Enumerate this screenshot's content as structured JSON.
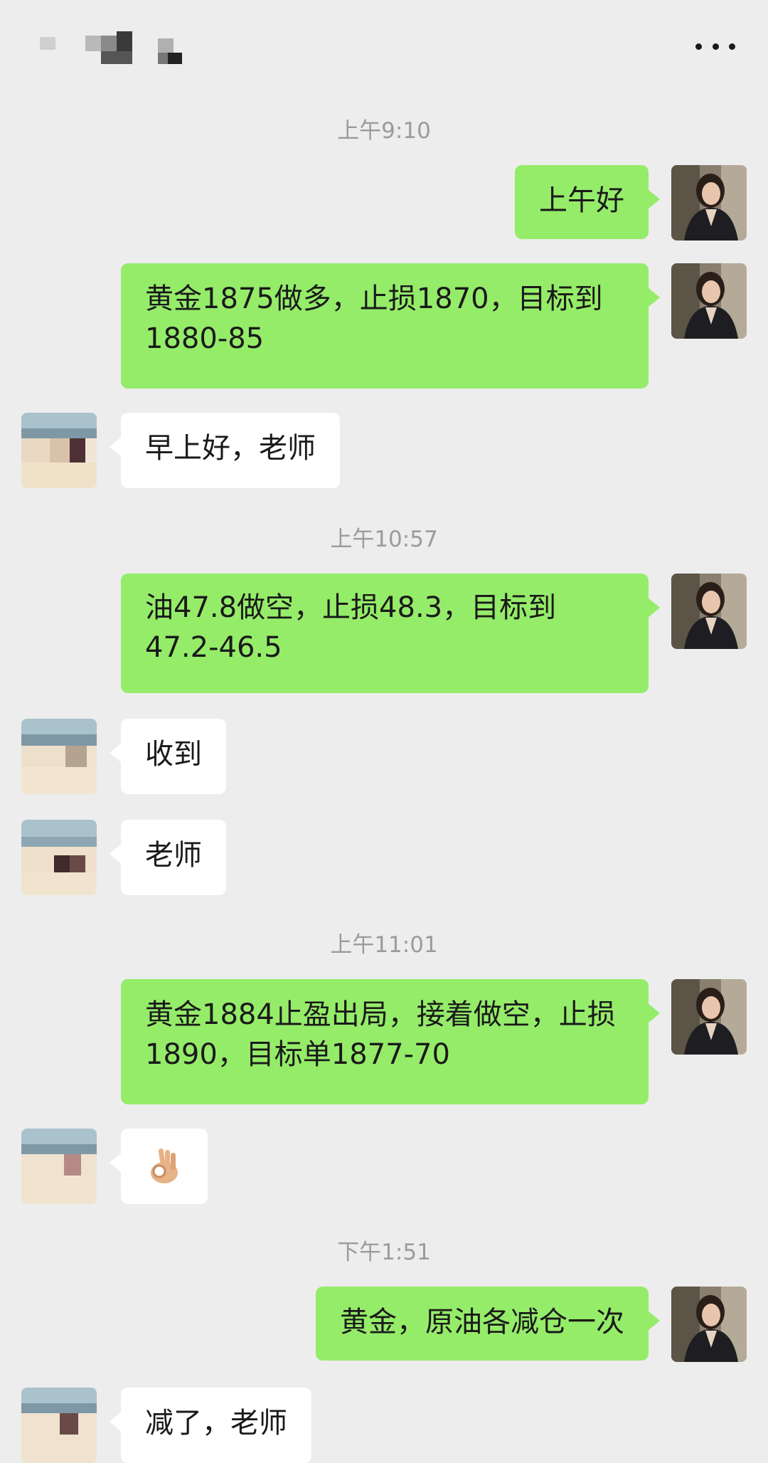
{
  "header": {
    "more_icon": "more-icon"
  },
  "colors": {
    "background": "#ededed",
    "my_bubble": "#95ec69",
    "other_bubble": "#ffffff",
    "timestamp": "#9b9b9b"
  },
  "messages": [
    {
      "type": "time",
      "text": "上午9:10"
    },
    {
      "type": "msg",
      "from": "me",
      "text": "上午好"
    },
    {
      "type": "msg",
      "from": "me",
      "text": "黄金1875做多，止损1870，目标到1880-85"
    },
    {
      "type": "msg",
      "from": "other",
      "text": "早上好，老师"
    },
    {
      "type": "time",
      "text": "上午10:57"
    },
    {
      "type": "msg",
      "from": "me",
      "text": "油47.8做空，止损48.3，目标到47.2-46.5"
    },
    {
      "type": "msg",
      "from": "other",
      "text": "收到"
    },
    {
      "type": "msg",
      "from": "other",
      "text": "老师"
    },
    {
      "type": "time",
      "text": "上午11:01"
    },
    {
      "type": "msg",
      "from": "me",
      "text": "黄金1884止盈出局，接着做空，止损1890，目标单1877-70"
    },
    {
      "type": "msg",
      "from": "other",
      "emoji": "ok-hand-emoji"
    },
    {
      "type": "time",
      "text": "下午1:51"
    },
    {
      "type": "msg",
      "from": "me",
      "text": "黄金，原油各减仓一次"
    },
    {
      "type": "msg",
      "from": "other",
      "text": "减了，老师"
    }
  ]
}
